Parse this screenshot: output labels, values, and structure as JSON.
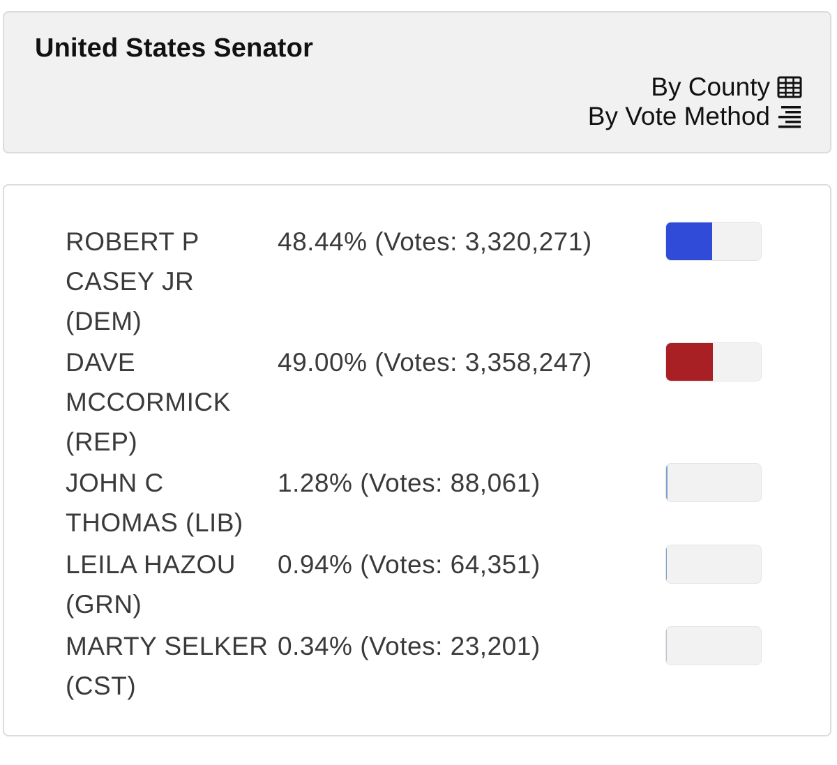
{
  "race": {
    "title": "United States Senator",
    "links": [
      {
        "label": "By County",
        "icon": "table-grid-icon"
      },
      {
        "label": "By Vote Method",
        "icon": "list-lines-icon"
      }
    ]
  },
  "candidates": [
    {
      "name": "ROBERT P CASEY JR (DEM)",
      "result": "48.44% (Votes: 3,320,271)",
      "percent": 48.44,
      "color": "#304bd8"
    },
    {
      "name": "DAVE MCCORMICK (REP)",
      "result": "49.00% (Votes: 3,358,247)",
      "percent": 49.0,
      "color": "#a81f24"
    },
    {
      "name": "JOHN C THOMAS (LIB)",
      "result": "1.28% (Votes: 88,061)",
      "percent": 1.28,
      "color": "#7a9fc8"
    },
    {
      "name": "LEILA HAZOU (GRN)",
      "result": "0.94% (Votes: 64,351)",
      "percent": 0.94,
      "color": "#7a9fc8"
    },
    {
      "name": "MARTY SELKER (CST)",
      "result": "0.34% (Votes: 23,201)",
      "percent": 0.34,
      "color": "#b9c4d0"
    }
  ]
}
